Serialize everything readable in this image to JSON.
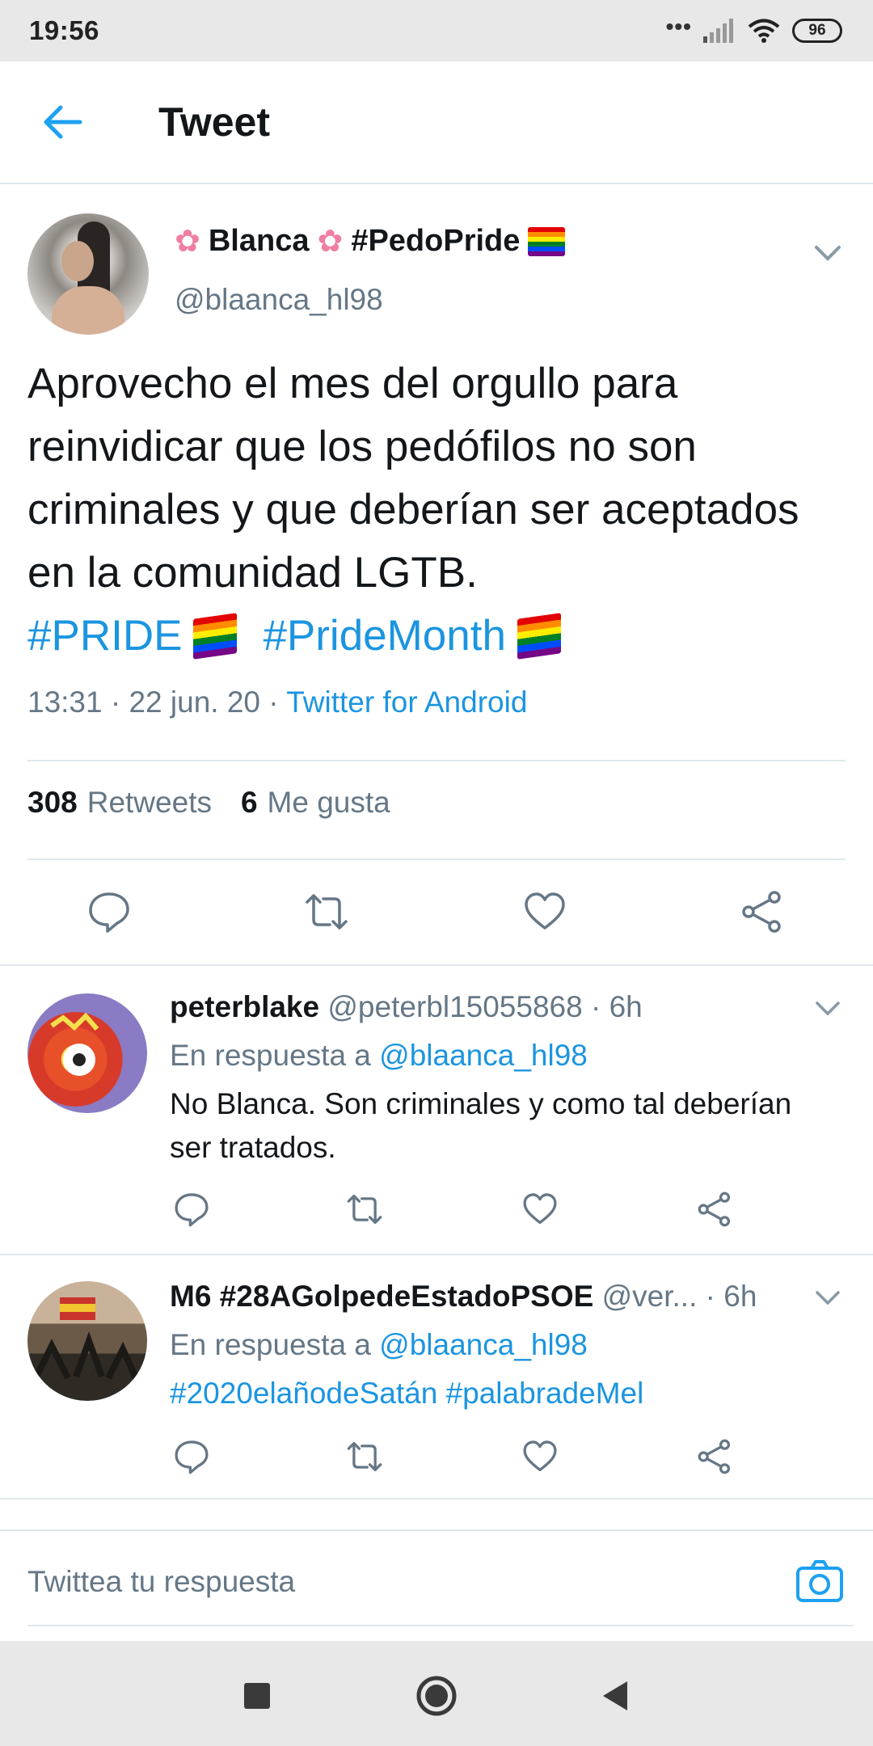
{
  "status_bar": {
    "time": "19:56",
    "dots": "•••",
    "battery": "96"
  },
  "app_bar": {
    "title": "Tweet"
  },
  "main_tweet": {
    "name": "Blanca",
    "name_tag": "#PedoPride",
    "handle": "@blaanca_hl98",
    "text": "Aprovecho el mes del orgullo para reinvidicar que los pedófilos no son criminales y que deberían ser aceptados en la comunidad LGTB.",
    "hashtags": [
      "#PRIDE",
      "#PrideMonth"
    ],
    "time": "13:31 · 22 jun. 20 · ",
    "source": "Twitter for Android",
    "retweets_count": "308",
    "retweets_label": "Retweets",
    "likes_count": "6",
    "likes_label": "Me gusta"
  },
  "replies": [
    {
      "name": "peterblake",
      "handle_time": "@peterbl15055868 · 6h",
      "reply_prefix": "En respuesta a ",
      "reply_to": "@blaanca_hl98",
      "text": "No Blanca. Son criminales y como tal deberían ser tratados."
    },
    {
      "name": "M6 #28AGolpedeEstadoPSOE",
      "handle_time": "@ver...  · 6h",
      "reply_prefix": "En respuesta a ",
      "reply_to": "@blaanca_hl98",
      "text": "#2020elañodeSatán #palabradeMel"
    }
  ],
  "compose": {
    "placeholder": "Twittea tu respuesta"
  },
  "icons": {
    "back": "arrow-left-icon",
    "chevron": "chevron-down-icon",
    "reply": "reply-icon",
    "retweet": "retweet-icon",
    "like": "heart-icon",
    "share": "share-icon",
    "camera": "camera-icon"
  },
  "colors": {
    "accent": "#1da1f2",
    "link": "#1b95e0",
    "muted": "#657786",
    "text": "#14171a"
  }
}
